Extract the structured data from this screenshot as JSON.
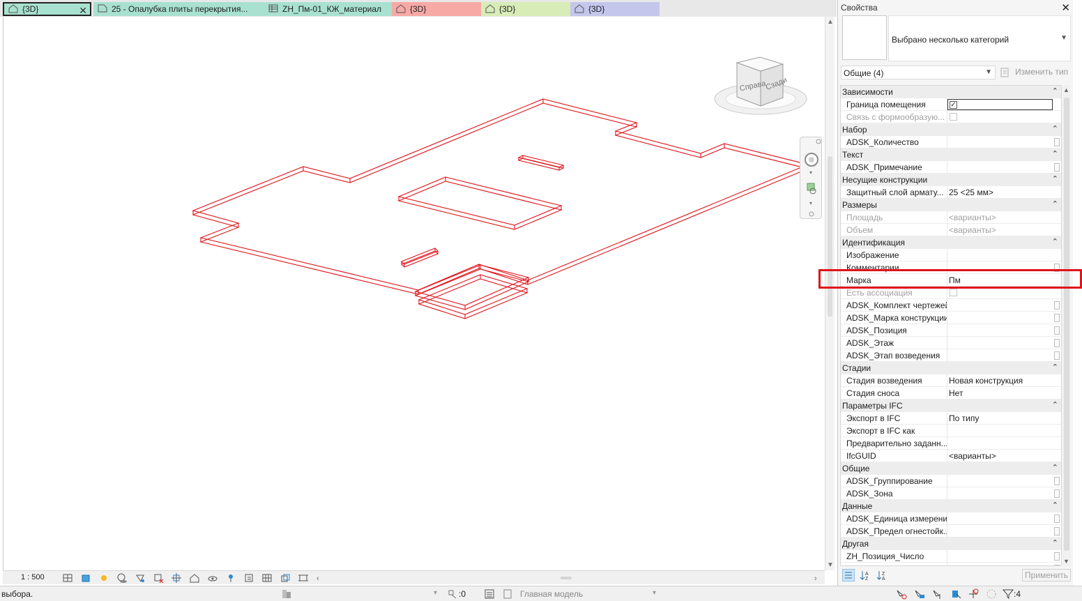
{
  "tabs": [
    {
      "label": "{3D}",
      "color": "#a8e1cf",
      "icon": "home-3d-icon",
      "active": true
    },
    {
      "label": "25 - Опалубка плиты перекрытия...",
      "color": "#a8e1cf",
      "icon": "sheet-icon"
    },
    {
      "label": "ZH_Пм-01_КЖ_материал",
      "color": "#a8e1cf",
      "icon": "schedule-icon"
    },
    {
      "label": "{3D}",
      "color": "#f7a9a6",
      "icon": "home-3d-icon"
    },
    {
      "label": "{3D}",
      "color": "#d8ecb7",
      "icon": "home-3d-icon"
    },
    {
      "label": "{3D}",
      "color": "#c4c6ec",
      "icon": "home-3d-icon"
    }
  ],
  "viewcube": {
    "right_face": "Справа",
    "back_face": "Сзади"
  },
  "view": {
    "scale": "1 : 500",
    "model_color": "#e0131a"
  },
  "status": {
    "message": "выбора.",
    "selection_count": ":0",
    "workset": "Главная модель",
    "filter_count": ":4"
  },
  "properties": {
    "title": "Свойства",
    "type_selector": "Выбрано несколько категорий",
    "filter": "Общие (4)",
    "edit_type": "Изменить тип",
    "apply": "Применить",
    "groups": [
      {
        "name": "Зависимости",
        "rows": [
          {
            "name": "Граница помещения",
            "kind": "checkbox-active",
            "value": ""
          },
          {
            "name": "Связь с формообразую...",
            "kind": "checkbox",
            "value": "",
            "dim": true
          }
        ]
      },
      {
        "name": "Набор",
        "rows": [
          {
            "name": "ADSK_Количество",
            "kind": "btn",
            "value": ""
          }
        ]
      },
      {
        "name": "Текст",
        "rows": [
          {
            "name": "ADSK_Примечание",
            "kind": "btn",
            "value": ""
          }
        ]
      },
      {
        "name": "Несущие конструкции",
        "rows": [
          {
            "name": "Защитный слой армату...",
            "kind": "text",
            "value": "25 <25 мм>"
          }
        ]
      },
      {
        "name": "Размеры",
        "rows": [
          {
            "name": "Площадь",
            "kind": "text",
            "value": "<варианты>",
            "dim": true
          },
          {
            "name": "Объем",
            "kind": "text",
            "value": "<варианты>",
            "dim": true
          }
        ]
      },
      {
        "name": "Идентификация",
        "rows": [
          {
            "name": "Изображение",
            "kind": "text",
            "value": ""
          },
          {
            "name": "Комментарии",
            "kind": "btn",
            "value": ""
          },
          {
            "name": "Марка",
            "kind": "text",
            "value": "Пм"
          },
          {
            "name": "Есть ассоциация",
            "kind": "checkbox",
            "value": "",
            "dim": true
          },
          {
            "name": "ADSK_Комплект чертежей",
            "kind": "btn",
            "value": ""
          },
          {
            "name": "ADSK_Марка конструкции",
            "kind": "btn",
            "value": ""
          },
          {
            "name": "ADSK_Позиция",
            "kind": "btn",
            "value": ""
          },
          {
            "name": "ADSK_Этаж",
            "kind": "btn",
            "value": ""
          },
          {
            "name": "ADSK_Этап возведения",
            "kind": "btn",
            "value": ""
          }
        ]
      },
      {
        "name": "Стадии",
        "rows": [
          {
            "name": "Стадия возведения",
            "kind": "text",
            "value": "Новая конструкция"
          },
          {
            "name": "Стадия сноса",
            "kind": "text",
            "value": "Нет"
          }
        ]
      },
      {
        "name": "Параметры IFC",
        "rows": [
          {
            "name": "Экспорт в IFC",
            "kind": "text",
            "value": "По типу"
          },
          {
            "name": "Экспорт в IFC как",
            "kind": "text",
            "value": ""
          },
          {
            "name": "Предварительно заданн...",
            "kind": "text",
            "value": ""
          },
          {
            "name": "IfcGUID",
            "kind": "text",
            "value": "<варианты>"
          }
        ]
      },
      {
        "name": "Общие",
        "rows": [
          {
            "name": "ADSK_Группирование",
            "kind": "btn",
            "value": ""
          },
          {
            "name": "ADSK_Зона",
            "kind": "btn",
            "value": ""
          }
        ]
      },
      {
        "name": "Данные",
        "rows": [
          {
            "name": "ADSK_Единица измерения",
            "kind": "btn",
            "value": ""
          },
          {
            "name": "ADSK_Предел огнестойк...",
            "kind": "btn",
            "value": ""
          }
        ]
      },
      {
        "name": "Другая",
        "rows": [
          {
            "name": "ZH_Позиция_Число",
            "kind": "btn",
            "value": ""
          },
          {
            "name": "ZH_Эта...",
            "kind": "btn",
            "value": ""
          }
        ]
      }
    ]
  }
}
